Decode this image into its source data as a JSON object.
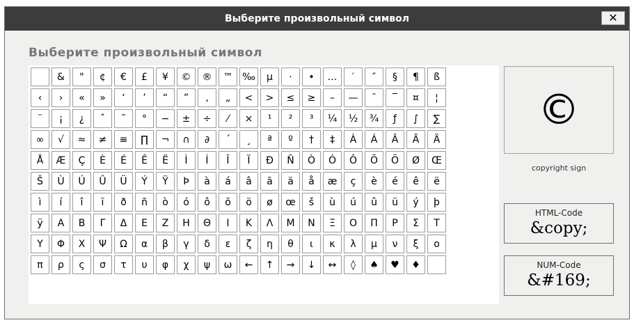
{
  "dialog": {
    "title": "Выберите произвольный символ",
    "close_label": "✕"
  },
  "heading": "Выберите произвольный символ",
  "grid": {
    "rows": [
      [
        "",
        "&",
        "\"",
        "¢",
        "€",
        "£",
        "¥",
        "©",
        "®",
        "™",
        "‰",
        "µ",
        "·",
        "•",
        "…",
        "′",
        "″",
        "§",
        "¶",
        "ß"
      ],
      [
        "‹",
        "›",
        "«",
        "»",
        "‘",
        "’",
        "“",
        "”",
        "‚",
        "„",
        "<",
        ">",
        "≤",
        "≥",
        "–",
        "—",
        "¯",
        "‾",
        "¤",
        "¦"
      ],
      [
        "¨",
        "¡",
        "¿",
        "ˆ",
        "˜",
        "°",
        "−",
        "±",
        "÷",
        "⁄",
        "×",
        "¹",
        "²",
        "³",
        "¼",
        "½",
        "¾",
        "ƒ",
        "∫",
        "∑"
      ],
      [
        "∞",
        "√",
        "≈",
        "≠",
        "≡",
        "∏",
        "¬",
        "∩",
        "∂",
        "´",
        "¸",
        "ª",
        "º",
        "†",
        "‡",
        "À",
        "Á",
        "Â",
        "Ã",
        "Ä"
      ],
      [
        "Å",
        "Æ",
        "Ç",
        "È",
        "É",
        "Ê",
        "Ë",
        "Ì",
        "Í",
        "Î",
        "Ï",
        "Ð",
        "Ñ",
        "Ò",
        "Ó",
        "Ô",
        "Õ",
        "Ö",
        "Ø",
        "Œ"
      ],
      [
        "Š",
        "Ù",
        "Ú",
        "Û",
        "Ü",
        "Ý",
        "Ÿ",
        "Þ",
        "à",
        "á",
        "â",
        "ã",
        "ä",
        "å",
        "æ",
        "ç",
        "è",
        "é",
        "ê",
        "ë"
      ],
      [
        "ì",
        "í",
        "î",
        "ï",
        "ð",
        "ñ",
        "ò",
        "ó",
        "ô",
        "õ",
        "ö",
        "ø",
        "œ",
        "š",
        "ù",
        "ú",
        "û",
        "ü",
        "ý",
        "þ"
      ],
      [
        "ÿ",
        "Α",
        "Β",
        "Γ",
        "Δ",
        "Ε",
        "Ζ",
        "Η",
        "Θ",
        "Ι",
        "Κ",
        "Λ",
        "Μ",
        "Ν",
        "Ξ",
        "Ο",
        "Π",
        "Ρ",
        "Σ",
        "Τ"
      ],
      [
        "Υ",
        "Φ",
        "Χ",
        "Ψ",
        "Ω",
        "α",
        "β",
        "γ",
        "δ",
        "ε",
        "ζ",
        "η",
        "θ",
        "ι",
        "κ",
        "λ",
        "μ",
        "ν",
        "ξ",
        "ο"
      ],
      [
        "π",
        "ρ",
        "ς",
        "σ",
        "τ",
        "υ",
        "φ",
        "χ",
        "ψ",
        "ω",
        "←",
        "↑",
        "→",
        "↓",
        "↔",
        "◊",
        "♠",
        "♥",
        "♦",
        ""
      ]
    ]
  },
  "preview": {
    "symbol": "©",
    "name": "copyright sign"
  },
  "html_code": {
    "label": "HTML-Code",
    "value": "&copy;"
  },
  "num_code": {
    "label": "NUM-Code",
    "value": "&#169;"
  }
}
